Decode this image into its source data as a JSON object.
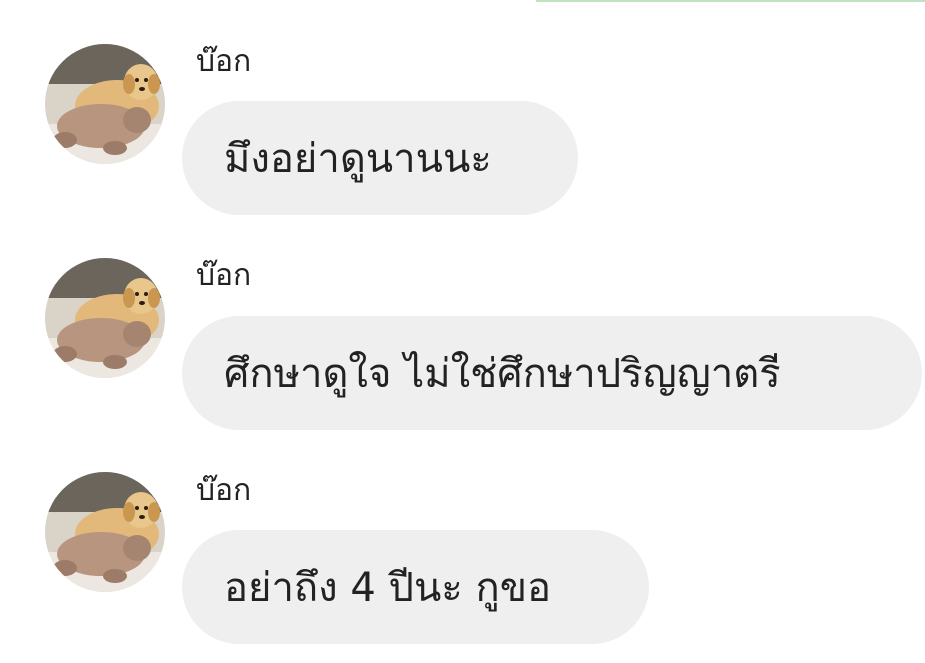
{
  "theme": {
    "bubble_color": "#efefef",
    "text_color": "#222222",
    "accent_line_color": "#bfe3c0"
  },
  "messages": [
    {
      "sender": "บ๊อก",
      "avatar_icon": "golden-retriever-puppy-avatar",
      "text": "มึงอย่าดูนานนะ"
    },
    {
      "sender": "บ๊อก",
      "avatar_icon": "golden-retriever-puppy-avatar",
      "text": "ศึกษาดูใจ ไม่ใช่ศึกษาปริญญาตรี"
    },
    {
      "sender": "บ๊อก",
      "avatar_icon": "golden-retriever-puppy-avatar",
      "text": "อย่าถึง 4 ปีนะ กูขอ"
    }
  ]
}
